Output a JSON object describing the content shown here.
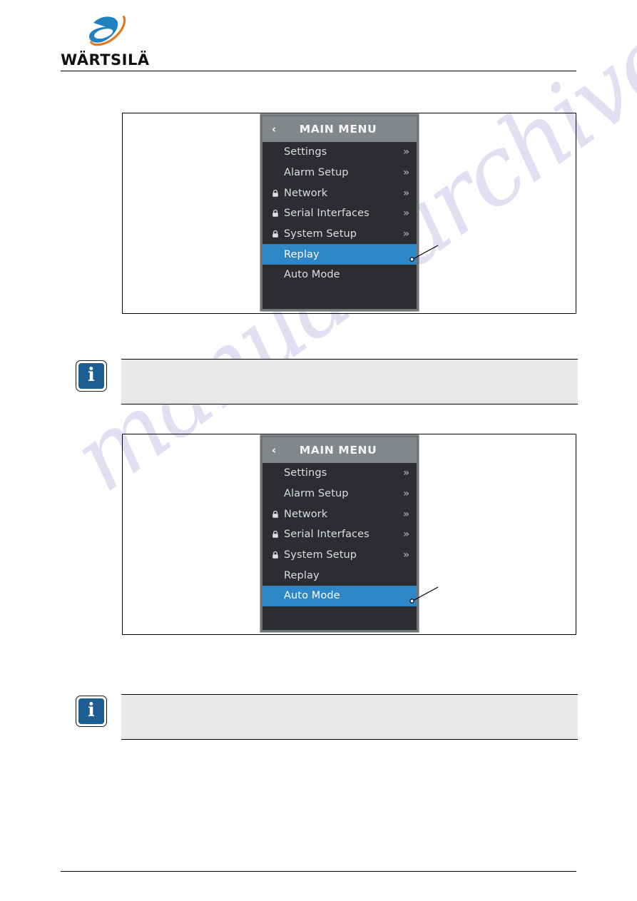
{
  "document": {
    "brand": {
      "wordmark": "WÄRTSILÄ",
      "logo_icon": "wartsila-swoosh-logo",
      "logo_blue": "#1f82c0",
      "logo_orange": "#e8761e"
    },
    "watermark": {
      "text": "manualsarchive.com",
      "color": "#c9c6e8"
    }
  },
  "figures": [
    {
      "id": "figure-1",
      "device": {
        "header": {
          "title": "MAIN MENU",
          "back_icon": "chevron-left-icon",
          "back_label": "‹",
          "background": "#83878a"
        },
        "selected_index": 5,
        "accent": "#2c86c8",
        "items": [
          {
            "label": "Settings",
            "locked": false,
            "has_submenu": true,
            "submenu_glyph": "»"
          },
          {
            "label": "Alarm Setup",
            "locked": false,
            "has_submenu": true,
            "submenu_glyph": "»"
          },
          {
            "label": "Network",
            "locked": true,
            "has_submenu": true,
            "submenu_glyph": "»"
          },
          {
            "label": "Serial Interfaces",
            "locked": true,
            "has_submenu": true,
            "submenu_glyph": "»"
          },
          {
            "label": "System Setup",
            "locked": true,
            "has_submenu": true,
            "submenu_glyph": "»"
          },
          {
            "label": "Replay",
            "locked": false,
            "has_submenu": false,
            "submenu_glyph": ""
          },
          {
            "label": "Auto Mode",
            "locked": false,
            "has_submenu": false,
            "submenu_glyph": ""
          }
        ]
      }
    },
    {
      "id": "figure-2",
      "device": {
        "header": {
          "title": "MAIN MENU",
          "back_icon": "chevron-left-icon",
          "back_label": "‹",
          "background": "#83878a"
        },
        "selected_index": 6,
        "accent": "#2c86c8",
        "items": [
          {
            "label": "Settings",
            "locked": false,
            "has_submenu": true,
            "submenu_glyph": "»"
          },
          {
            "label": "Alarm Setup",
            "locked": false,
            "has_submenu": true,
            "submenu_glyph": "»"
          },
          {
            "label": "Network",
            "locked": true,
            "has_submenu": true,
            "submenu_glyph": "»"
          },
          {
            "label": "Serial Interfaces",
            "locked": true,
            "has_submenu": true,
            "submenu_glyph": "»"
          },
          {
            "label": "System Setup",
            "locked": true,
            "has_submenu": true,
            "submenu_glyph": "»"
          },
          {
            "label": "Replay",
            "locked": false,
            "has_submenu": false,
            "submenu_glyph": ""
          },
          {
            "label": "Auto Mode",
            "locked": false,
            "has_submenu": false,
            "submenu_glyph": ""
          }
        ]
      }
    }
  ],
  "notes": [
    {
      "id": "note-1",
      "icon": "info-icon",
      "glyph": "i",
      "text": ""
    },
    {
      "id": "note-2",
      "icon": "info-icon",
      "glyph": "i",
      "text": ""
    }
  ]
}
